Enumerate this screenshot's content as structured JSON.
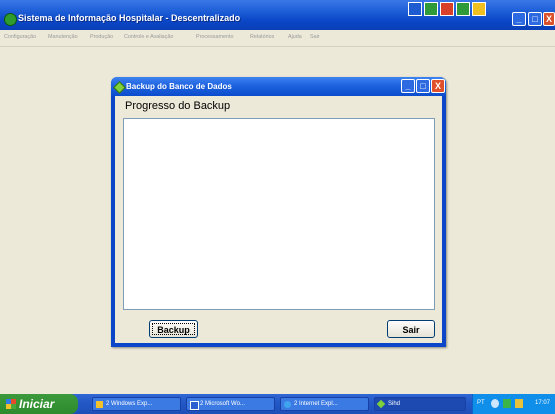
{
  "app": {
    "title": "Sistema de Informação Hospitalar - Descentralizado",
    "controls": {
      "minimize": "_",
      "maximize": "□",
      "close": "X"
    }
  },
  "menu": [
    "Configuração",
    "Manutenção",
    "Produção",
    "Controle e Avaliação",
    "Processamento",
    "Relatórios",
    "Ajuda",
    "Sair"
  ],
  "dialog": {
    "title": "Backup do Banco de Dados",
    "progress_label": "Progresso do Backup",
    "backup_button": "Backup",
    "exit_button": "Sair",
    "controls": {
      "minimize": "_",
      "maximize": "□",
      "close": "X"
    }
  },
  "taskbar": {
    "start_label": "Iniciar",
    "tasks": [
      {
        "label": "2 Windows Exp...",
        "icon": "folder-icon"
      },
      {
        "label": "2 Microsoft Wo...",
        "icon": "word-icon"
      },
      {
        "label": "2 Internet Expl...",
        "icon": "ie-icon"
      },
      {
        "label": "Sihd",
        "icon": "app-icon"
      }
    ],
    "language": "PT",
    "clock": "17:07"
  },
  "colors": {
    "titlebar": "#0a46c7",
    "face": "#ece9d8",
    "start": "#2d8a2d",
    "close": "#e0502a"
  }
}
